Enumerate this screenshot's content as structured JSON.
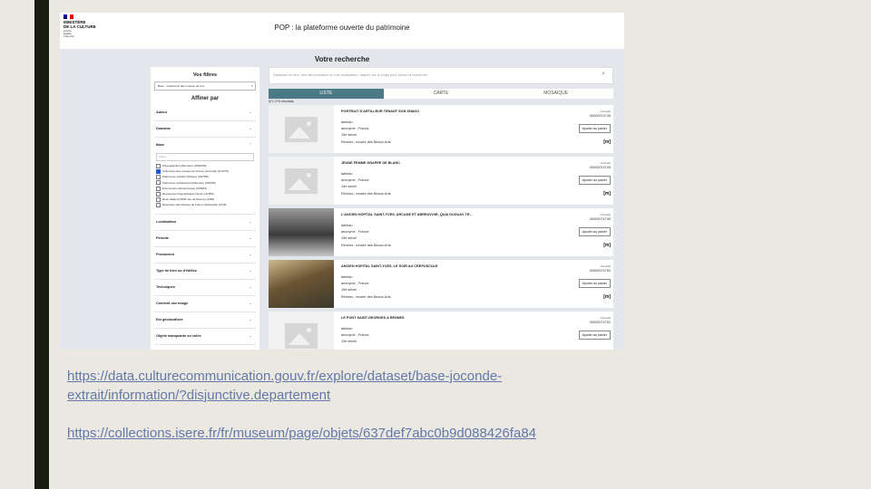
{
  "header": {
    "logo_lines": [
      "MINISTÈRE",
      "DE LA CULTURE"
    ],
    "logo_motto": [
      "Liberté",
      "Égalité",
      "Fraternité"
    ],
    "flag_colors": [
      "#000091",
      "#ffffff",
      "#e1000f"
    ],
    "site_title": "POP : la plateforme ouverte du patrimoine"
  },
  "page": {
    "section_title": "Votre recherche"
  },
  "filters": {
    "title": "Vos filtres",
    "active_filter": "Base : Collections des musées de Fra...",
    "active_filter_remove": "×",
    "subtitle": "Affiner par",
    "groups_before": [
      "Auteur",
      "Domaine"
    ],
    "base_label": "Base",
    "base_search_placeholder": "Filtrer...",
    "base_options": [
      {
        "label": "Photographies (Mémoire) (2562298)",
        "checked": false
      },
      {
        "label": "Collections des musées de France (Joconde) (671275)",
        "checked": true
      },
      {
        "label": "Patrimoine mobilier (Palissy) (342788)",
        "checked": false
      },
      {
        "label": "Patrimoine architectural (Mérimée) (329756)",
        "checked": false
      },
      {
        "label": "Enluminures (Enluminures) (159863)",
        "checked": false
      },
      {
        "label": "Ressources biographiques (Autor) (21859)",
        "checked": false
      },
      {
        "label": "Rose Valland (MNR-Jeu de Paume) (2456)",
        "checked": false
      },
      {
        "label": "Répertoire des Musées de France (Muséofile) (1228)",
        "checked": false
      }
    ],
    "groups_after": [
      "Localisation",
      "Période",
      "Producteur",
      "Type de bien ou d'édifice",
      "Techniques",
      "Contient une image",
      "Est géolocalisée",
      "Objets manquants ou volés"
    ]
  },
  "search": {
    "placeholder": "Saisissez un titre, une dénomination ou une localisation, cliquez sur la loupe pour lancer la recherche",
    "icon": "magnifier-icon"
  },
  "tabs": [
    {
      "label": "LISTE",
      "active": true
    },
    {
      "label": "CARTE",
      "active": false
    },
    {
      "label": "MOSAIQUE",
      "active": false
    }
  ],
  "result_count": "671 275 résultats",
  "results": [
    {
      "title": "PORTRAIT D'ARTILLEUR TENANT SON SHAKO",
      "type": "tableau",
      "author": "anonyme ; France",
      "period": "19e siècle",
      "museum": "Rennes ; musée des Beaux-Arts",
      "source": "Joconde",
      "ref": "00000074735",
      "button": "Ajouter au panier",
      "mh": "[m]"
    },
    {
      "title": "JEUNE FEMME DRAPEE DE BLANC",
      "type": "tableau",
      "author": "anonyme ; France",
      "period": "19e siècle",
      "museum": "Rennes ; musée des Beaux-Arts",
      "source": "Joconde",
      "ref": "00000074745",
      "button": "Ajouter au panier",
      "mh": "[m]"
    },
    {
      "title": "L'ANCIEN HOPITAL SAINT-YVES, ARCADE ET ABREUVOIR, QUAI DUGUAY-TR...",
      "type": "tableau",
      "author": "anonyme ; France",
      "period": "19e siècle",
      "museum": "Rennes ; musée des Beaux-Arts",
      "source": "Joconde",
      "ref": "00000074749",
      "button": "Ajouter au panier",
      "mh": "[m]"
    },
    {
      "title": "ANCIEN HOPITAL SAINT-YVES, LE SOIR AU CREPUSCULE",
      "type": "tableau",
      "author": "anonyme ; France",
      "period": "19e siècle",
      "museum": "Rennes ; musée des Beaux-Arts",
      "source": "Joconde",
      "ref": "00000074750",
      "button": "Ajouter au panier",
      "mh": "[m]"
    },
    {
      "title": "LE PONT SAINT-GEORGES A RENNES",
      "type": "tableau",
      "author": "anonyme ; France",
      "period": "19e siècle",
      "museum": "",
      "source": "Joconde",
      "ref": "00000074751",
      "button": "Ajouter au panier",
      "mh": ""
    }
  ],
  "links": [
    "https://data.culturecommunication.gouv.fr/explore/dataset/base-joconde-",
    "extrait/information/?disjunctive.departement",
    "https://collections.isere.fr/fr/museum/page/objets/637def7abc0b9d088426fa84"
  ]
}
